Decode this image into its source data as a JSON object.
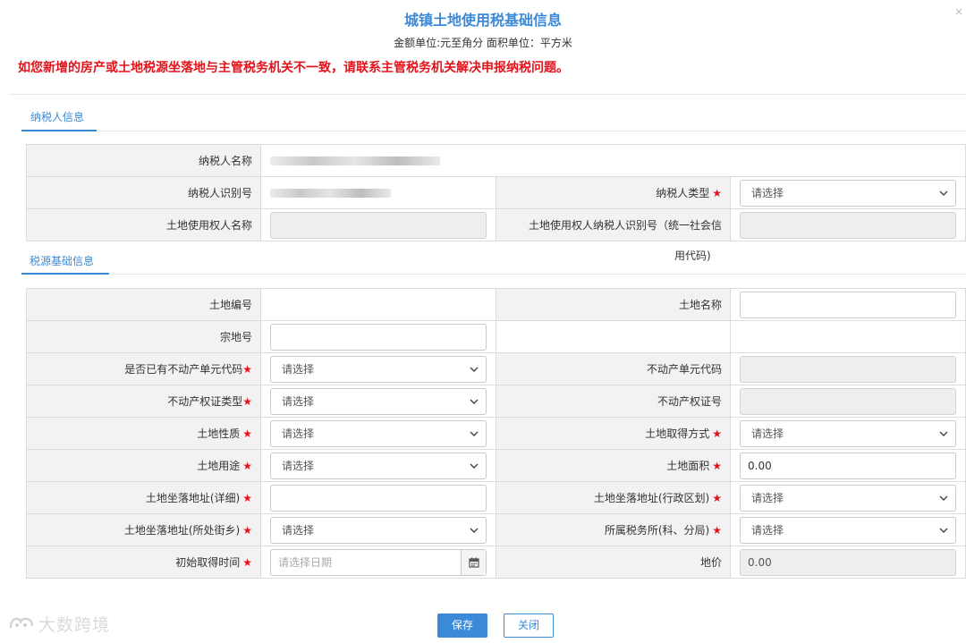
{
  "dialog": {
    "title": "城镇土地使用税基础信息",
    "subtitle": "金额单位:元至角分 面积单位：平方米",
    "warning": "如您新增的房产或土地税源坐落地与主管税务机关不一致，请联系主管税务机关解决申报纳税问题。",
    "close_icon": "×"
  },
  "taxpayer_section": {
    "tab_label": "纳税人信息",
    "name_label": "纳税人名称",
    "id_label": "纳税人识别号",
    "type_label": "纳税人类型",
    "type_value": "请选择",
    "land_user_name_label": "土地使用权人名称",
    "land_user_id_label_line1": "土地使用权人纳税人识别号（统一社会信",
    "land_user_id_label_line2": "用代码)"
  },
  "source_section": {
    "tab_label": "税源基础信息",
    "land_no_label": "土地编号",
    "land_name_label": "土地名称",
    "parcel_no_label": "宗地号",
    "has_unit_code_label": "是否已有不动产单元代码",
    "has_unit_code_value": "请选择",
    "unit_code_label": "不动产单元代码",
    "cert_type_label": "不动产权证类型",
    "cert_type_value": "请选择",
    "cert_no_label": "不动产权证号",
    "land_nature_label": "土地性质",
    "land_nature_value": "请选择",
    "acquire_method_label": "土地取得方式",
    "acquire_method_value": "请选择",
    "land_use_label": "土地用途",
    "land_use_value": "请选择",
    "land_area_label": "土地面积",
    "land_area_value": "0.00",
    "address_detail_label": "土地坐落地址(详细)",
    "address_region_label": "土地坐落地址(行政区划)",
    "address_region_value": "请选择",
    "address_street_label": "土地坐落地址(所处街乡)",
    "address_street_value": "请选择",
    "tax_office_label": "所属税务所(科、分局)",
    "tax_office_value": "请选择",
    "initial_date_label": "初始取得时间",
    "initial_date_placeholder": "请选择日期",
    "land_price_label": "地价",
    "land_price_value": "0.00"
  },
  "buttons": {
    "save": "保存",
    "close": "关闭"
  },
  "watermark": "大数跨境",
  "colors": {
    "accent": "#3a8ad8",
    "required": "#e3131b",
    "label_bg": "#f2f2f2"
  }
}
